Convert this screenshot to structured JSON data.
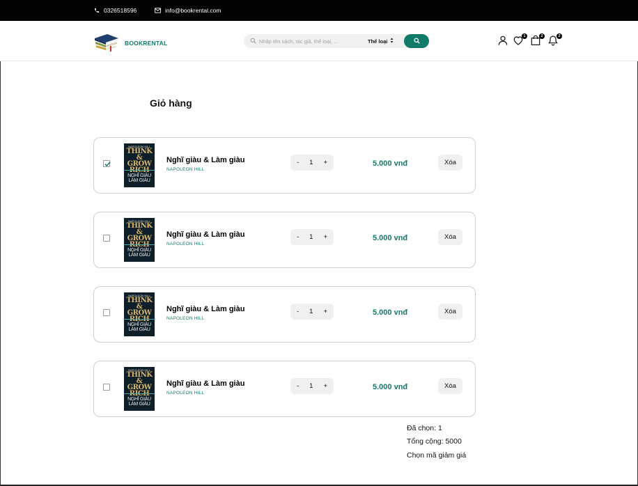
{
  "topbar": {
    "phone": "0326518596",
    "email": "info@bookrental.com"
  },
  "header": {
    "brand": "BOOKRENTAL",
    "search_placeholder": "Nhập tên sách, tác giả, thể loại, ...",
    "category_label": "Thể loại",
    "wishlist_count": "1",
    "cart_count": "2",
    "notification_count": "2"
  },
  "page": {
    "title": "Giỏ hàng"
  },
  "cart": {
    "items": [
      {
        "name": "Nghĩ giàu & Làm giàu",
        "author": "NAPOLEON HILL",
        "qty": "1",
        "price": "5.000 vnđ",
        "delete_label": "Xóa",
        "checked": true
      },
      {
        "name": "Nghĩ giàu & Làm giàu",
        "author": "NAPOLEON HILL",
        "qty": "1",
        "price": "5.000 vnđ",
        "delete_label": "Xóa",
        "checked": false
      },
      {
        "name": "Nghĩ giàu & Làm giàu",
        "author": "NAPOLEON HILL",
        "qty": "1",
        "price": "5.000 vnđ",
        "delete_label": "Xóa",
        "checked": false
      },
      {
        "name": "Nghĩ giàu & Làm giàu",
        "author": "NAPOLEON HILL",
        "qty": "1",
        "price": "5.000 vnđ",
        "delete_label": "Xóa",
        "checked": false
      }
    ],
    "minus": "-",
    "plus": "+"
  },
  "cover": {
    "top_text": "NAPOLEON HILL",
    "title_lines": [
      "THINK &",
      "GROW",
      "RICH"
    ],
    "vn_lines": [
      "NGHĨ GIÀU",
      "LÀM GIÀU"
    ]
  },
  "summary": {
    "selected": "Đã chọn: 1",
    "total": "Tổng cộng: 5000",
    "voucher": "Chọn mã giảm giá"
  },
  "colors": {
    "accent": "#107a68",
    "topbar": "#000000"
  },
  "icons": [
    "phone-icon",
    "mail-icon",
    "search-icon",
    "sort-icon",
    "user-icon",
    "heart-icon",
    "bag-icon",
    "bell-icon",
    "check-icon"
  ]
}
